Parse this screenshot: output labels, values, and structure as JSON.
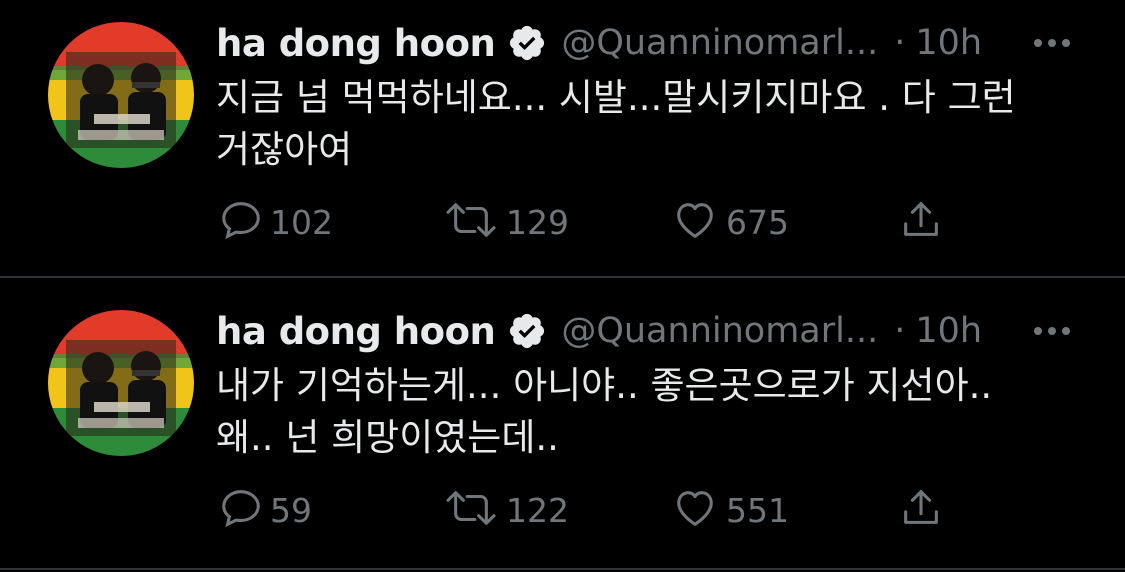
{
  "colors": {
    "background": "#000000",
    "text_primary": "#e7e9ea",
    "text_secondary": "#71767b",
    "divider": "#2f3336"
  },
  "tweets": [
    {
      "author_name": "ha dong hoon",
      "verified": true,
      "handle": "@Quanninomarl...",
      "separator": "·",
      "time": "10h",
      "text": "지금 넘 먹먹하네요... 시발...말시키지마요 . 다 그런\n거잖아여",
      "replies": "102",
      "retweets": "129",
      "likes": "675",
      "icons": {
        "reply": "reply-icon",
        "retweet": "retweet-icon",
        "like": "heart-icon",
        "share": "share-icon",
        "more": "more-icon",
        "verified": "verified-badge-icon"
      }
    },
    {
      "author_name": "ha dong hoon",
      "verified": true,
      "handle": "@Quanninomarl...",
      "separator": "·",
      "time": "10h",
      "text": "내가 기억하는게... 아니야.. 좋은곳으로가 지선아..\n왜.. 넌 희망이였는데..",
      "replies": "59",
      "retweets": "122",
      "likes": "551",
      "icons": {
        "reply": "reply-icon",
        "retweet": "retweet-icon",
        "like": "heart-icon",
        "share": "share-icon",
        "more": "more-icon",
        "verified": "verified-badge-icon"
      }
    }
  ]
}
